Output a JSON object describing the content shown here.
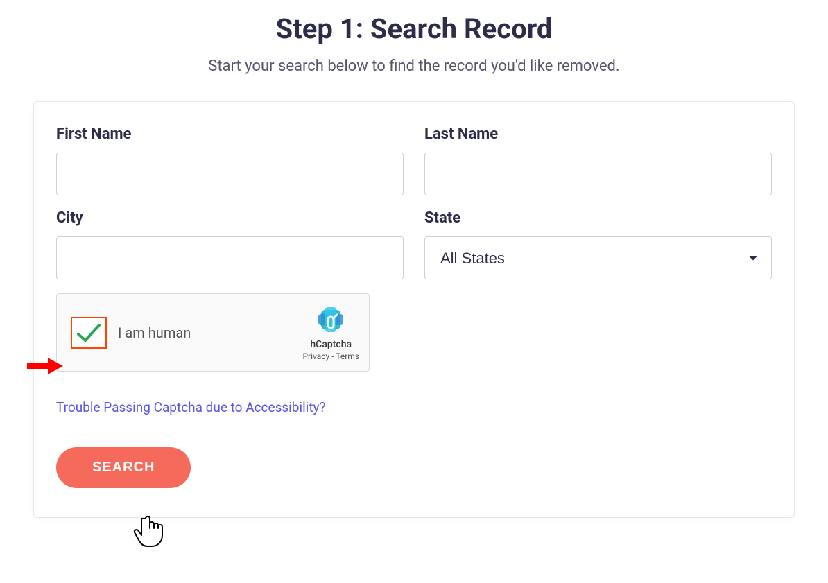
{
  "header": {
    "title": "Step 1: Search Record",
    "subtitle": "Start your search below to find the record you'd like removed."
  },
  "form": {
    "first_name": {
      "label": "First Name",
      "value": ""
    },
    "last_name": {
      "label": "Last Name",
      "value": ""
    },
    "city": {
      "label": "City",
      "value": ""
    },
    "state": {
      "label": "State",
      "selected": "All States"
    }
  },
  "captcha": {
    "label": "I am human",
    "brand": "hCaptcha",
    "privacy": "Privacy",
    "sep": " - ",
    "terms": "Terms"
  },
  "accessibility_link": "Trouble Passing Captcha due to Accessibility?",
  "search_button": "SEARCH"
}
